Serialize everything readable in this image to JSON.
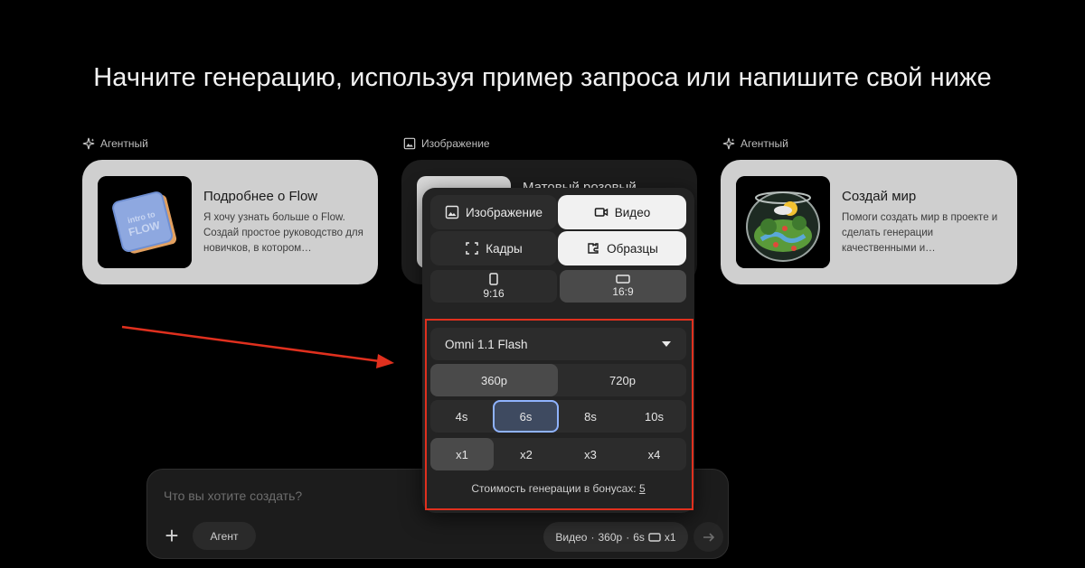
{
  "headline": "Начните генерацию, используя пример запроса или напишите свой ниже",
  "cards": [
    {
      "section": "Агентный",
      "title": "Подробнее о Flow",
      "description": "Я хочу узнать больше о Flow. Создай простое руководство для новичков, в котором…",
      "thumb_text": "Intro to FLOW"
    },
    {
      "section": "Изображение",
      "title": "Матовый розовый"
    },
    {
      "section": "Агентный",
      "title": "Создай мир",
      "description": "Помоги создать мир в проекте и сделать генерации качественными и…"
    }
  ],
  "composer": {
    "placeholder": "Что вы хотите создать?",
    "agent_button": "Агент",
    "settings_chip": {
      "mode": "Видео",
      "resolution": "360p",
      "duration": "6s",
      "count": "x1"
    }
  },
  "panel": {
    "mode_tabs": [
      {
        "label": "Изображение",
        "icon": "image-icon",
        "selected": false
      },
      {
        "label": "Видео",
        "icon": "video-icon",
        "selected": true
      }
    ],
    "source_tabs": [
      {
        "label": "Кадры",
        "icon": "frames-icon",
        "selected": false
      },
      {
        "label": "Образцы",
        "icon": "ingredients-icon",
        "selected": true
      }
    ],
    "aspect_ratios": [
      {
        "label": "9:16",
        "icon": "portrait-icon",
        "selected": false
      },
      {
        "label": "16:9",
        "icon": "landscape-icon",
        "selected": true
      }
    ],
    "model": {
      "label": "Omni 1.1 Flash"
    },
    "resolutions": [
      {
        "label": "360p",
        "selected": true
      },
      {
        "label": "720p",
        "selected": false
      }
    ],
    "durations": [
      {
        "label": "4s",
        "selected": false
      },
      {
        "label": "6s",
        "selected": true
      },
      {
        "label": "8s",
        "selected": false
      },
      {
        "label": "10s",
        "selected": false
      }
    ],
    "counts": [
      {
        "label": "x1",
        "selected": true
      },
      {
        "label": "x2",
        "selected": false
      },
      {
        "label": "x3",
        "selected": false
      },
      {
        "label": "x4",
        "selected": false
      }
    ],
    "cost_label": "Стоимость генерации в бонусах:",
    "cost_value": "5"
  },
  "annotation": {
    "color": "#e0301e"
  }
}
